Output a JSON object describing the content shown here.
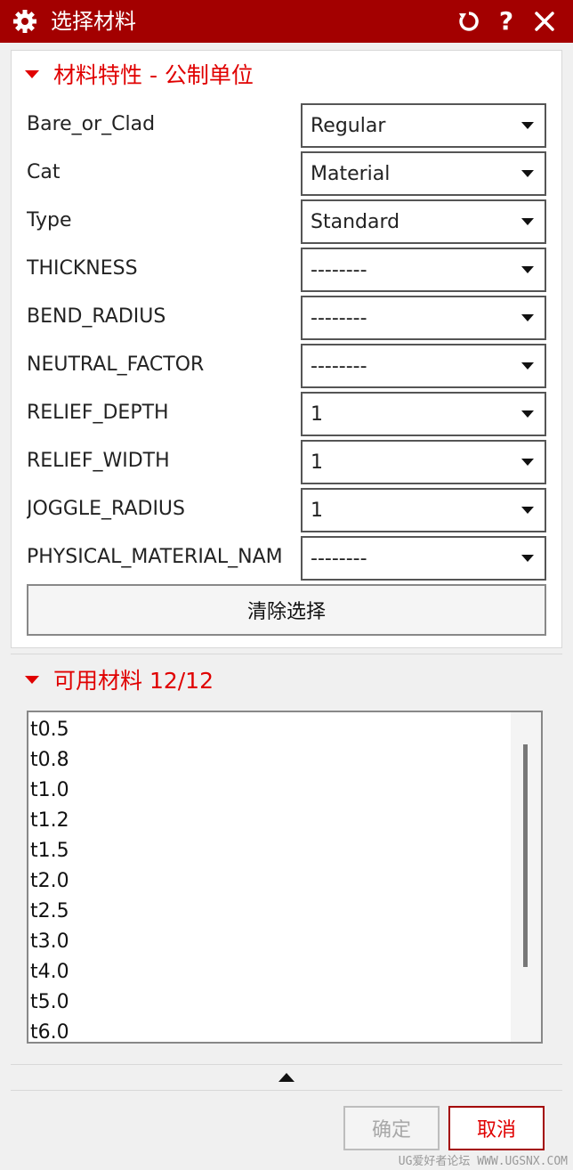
{
  "window": {
    "title": "选择材料",
    "icons": {
      "app": "gear-icon",
      "reset": "reset-icon",
      "help": "?",
      "close": "close-icon"
    }
  },
  "properties_group": {
    "header": "材料特性 - 公制单位",
    "rows": [
      {
        "label": "Bare_or_Clad",
        "value": "Regular"
      },
      {
        "label": "Cat",
        "value": "Material"
      },
      {
        "label": "Type",
        "value": "Standard"
      },
      {
        "label": "THICKNESS",
        "value": "--------"
      },
      {
        "label": "BEND_RADIUS",
        "value": "--------"
      },
      {
        "label": "NEUTRAL_FACTOR",
        "value": "--------"
      },
      {
        "label": "RELIEF_DEPTH",
        "value": "1"
      },
      {
        "label": "RELIEF_WIDTH",
        "value": "1"
      },
      {
        "label": "JOGGLE_RADIUS",
        "value": "1"
      },
      {
        "label": "PHYSICAL_MATERIAL_NAM",
        "value": "--------"
      }
    ],
    "clear_button": "清除选择"
  },
  "materials_group": {
    "header": "可用材料 12/12",
    "items": [
      "t0.5",
      "t0.8",
      "t1.0",
      "t1.2",
      "t1.5",
      "t2.0",
      "t2.5",
      "t3.0",
      "t4.0",
      "t5.0",
      "t6.0"
    ]
  },
  "footer": {
    "ok_label": "确定",
    "cancel_label": "取消",
    "ok_enabled": false
  },
  "watermark": "UG爱好者论坛 WWW.UGSNX.COM",
  "colors": {
    "titlebar": "#a30000",
    "accent": "#e00000"
  }
}
